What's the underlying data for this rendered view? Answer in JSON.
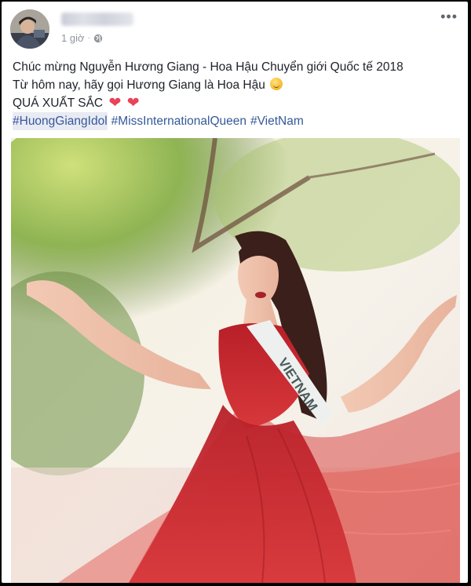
{
  "post": {
    "timestamp": "1 giờ",
    "separator": "·",
    "more_label": "•••",
    "lines": [
      "Chúc mừng Nguyễn Hương Giang - Hoa Hậu Chuyển giới Quốc tế 2018",
      "Từ hôm nay, hãy gọi Hương Giang là Hoa Hậu",
      "QUÁ XUẤT SẮC"
    ],
    "hashtags": [
      "#HuongGiangIdol",
      "#MissInternationalQueen",
      "#VietNam"
    ]
  },
  "photo": {
    "sash_text": "VIETNAM"
  },
  "icons": [
    "globe-icon",
    "more-options-icon",
    "smile-emoji-icon",
    "heart-emoji-icon"
  ],
  "colors": {
    "link": "#365899",
    "text": "#1d2129",
    "meta": "#90949c",
    "heart": "#e8435a",
    "dress": "#c8262b"
  }
}
